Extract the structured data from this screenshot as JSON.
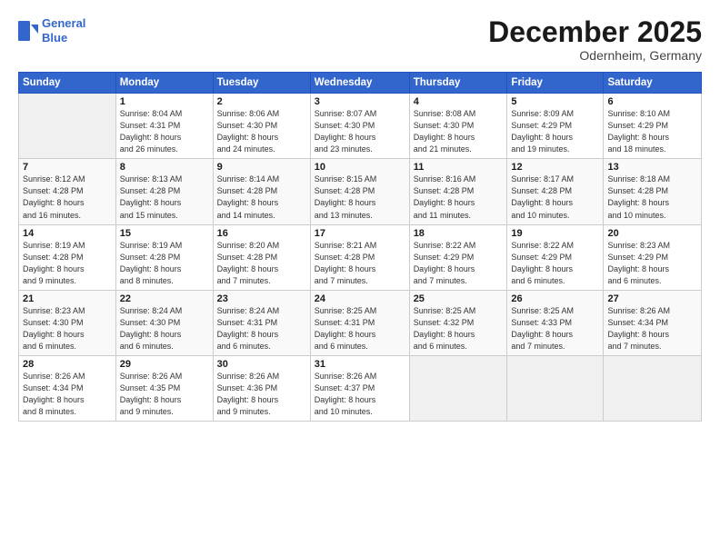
{
  "logo": {
    "line1": "General",
    "line2": "Blue"
  },
  "title": "December 2025",
  "subtitle": "Odernheim, Germany",
  "days_header": [
    "Sunday",
    "Monday",
    "Tuesday",
    "Wednesday",
    "Thursday",
    "Friday",
    "Saturday"
  ],
  "weeks": [
    [
      {
        "num": "",
        "info": ""
      },
      {
        "num": "1",
        "info": "Sunrise: 8:04 AM\nSunset: 4:31 PM\nDaylight: 8 hours\nand 26 minutes."
      },
      {
        "num": "2",
        "info": "Sunrise: 8:06 AM\nSunset: 4:30 PM\nDaylight: 8 hours\nand 24 minutes."
      },
      {
        "num": "3",
        "info": "Sunrise: 8:07 AM\nSunset: 4:30 PM\nDaylight: 8 hours\nand 23 minutes."
      },
      {
        "num": "4",
        "info": "Sunrise: 8:08 AM\nSunset: 4:30 PM\nDaylight: 8 hours\nand 21 minutes."
      },
      {
        "num": "5",
        "info": "Sunrise: 8:09 AM\nSunset: 4:29 PM\nDaylight: 8 hours\nand 19 minutes."
      },
      {
        "num": "6",
        "info": "Sunrise: 8:10 AM\nSunset: 4:29 PM\nDaylight: 8 hours\nand 18 minutes."
      }
    ],
    [
      {
        "num": "7",
        "info": "Sunrise: 8:12 AM\nSunset: 4:28 PM\nDaylight: 8 hours\nand 16 minutes."
      },
      {
        "num": "8",
        "info": "Sunrise: 8:13 AM\nSunset: 4:28 PM\nDaylight: 8 hours\nand 15 minutes."
      },
      {
        "num": "9",
        "info": "Sunrise: 8:14 AM\nSunset: 4:28 PM\nDaylight: 8 hours\nand 14 minutes."
      },
      {
        "num": "10",
        "info": "Sunrise: 8:15 AM\nSunset: 4:28 PM\nDaylight: 8 hours\nand 13 minutes."
      },
      {
        "num": "11",
        "info": "Sunrise: 8:16 AM\nSunset: 4:28 PM\nDaylight: 8 hours\nand 11 minutes."
      },
      {
        "num": "12",
        "info": "Sunrise: 8:17 AM\nSunset: 4:28 PM\nDaylight: 8 hours\nand 10 minutes."
      },
      {
        "num": "13",
        "info": "Sunrise: 8:18 AM\nSunset: 4:28 PM\nDaylight: 8 hours\nand 10 minutes."
      }
    ],
    [
      {
        "num": "14",
        "info": "Sunrise: 8:19 AM\nSunset: 4:28 PM\nDaylight: 8 hours\nand 9 minutes."
      },
      {
        "num": "15",
        "info": "Sunrise: 8:19 AM\nSunset: 4:28 PM\nDaylight: 8 hours\nand 8 minutes."
      },
      {
        "num": "16",
        "info": "Sunrise: 8:20 AM\nSunset: 4:28 PM\nDaylight: 8 hours\nand 7 minutes."
      },
      {
        "num": "17",
        "info": "Sunrise: 8:21 AM\nSunset: 4:28 PM\nDaylight: 8 hours\nand 7 minutes."
      },
      {
        "num": "18",
        "info": "Sunrise: 8:22 AM\nSunset: 4:29 PM\nDaylight: 8 hours\nand 7 minutes."
      },
      {
        "num": "19",
        "info": "Sunrise: 8:22 AM\nSunset: 4:29 PM\nDaylight: 8 hours\nand 6 minutes."
      },
      {
        "num": "20",
        "info": "Sunrise: 8:23 AM\nSunset: 4:29 PM\nDaylight: 8 hours\nand 6 minutes."
      }
    ],
    [
      {
        "num": "21",
        "info": "Sunrise: 8:23 AM\nSunset: 4:30 PM\nDaylight: 8 hours\nand 6 minutes."
      },
      {
        "num": "22",
        "info": "Sunrise: 8:24 AM\nSunset: 4:30 PM\nDaylight: 8 hours\nand 6 minutes."
      },
      {
        "num": "23",
        "info": "Sunrise: 8:24 AM\nSunset: 4:31 PM\nDaylight: 8 hours\nand 6 minutes."
      },
      {
        "num": "24",
        "info": "Sunrise: 8:25 AM\nSunset: 4:31 PM\nDaylight: 8 hours\nand 6 minutes."
      },
      {
        "num": "25",
        "info": "Sunrise: 8:25 AM\nSunset: 4:32 PM\nDaylight: 8 hours\nand 6 minutes."
      },
      {
        "num": "26",
        "info": "Sunrise: 8:25 AM\nSunset: 4:33 PM\nDaylight: 8 hours\nand 7 minutes."
      },
      {
        "num": "27",
        "info": "Sunrise: 8:26 AM\nSunset: 4:34 PM\nDaylight: 8 hours\nand 7 minutes."
      }
    ],
    [
      {
        "num": "28",
        "info": "Sunrise: 8:26 AM\nSunset: 4:34 PM\nDaylight: 8 hours\nand 8 minutes."
      },
      {
        "num": "29",
        "info": "Sunrise: 8:26 AM\nSunset: 4:35 PM\nDaylight: 8 hours\nand 9 minutes."
      },
      {
        "num": "30",
        "info": "Sunrise: 8:26 AM\nSunset: 4:36 PM\nDaylight: 8 hours\nand 9 minutes."
      },
      {
        "num": "31",
        "info": "Sunrise: 8:26 AM\nSunset: 4:37 PM\nDaylight: 8 hours\nand 10 minutes."
      },
      {
        "num": "",
        "info": ""
      },
      {
        "num": "",
        "info": ""
      },
      {
        "num": "",
        "info": ""
      }
    ]
  ]
}
